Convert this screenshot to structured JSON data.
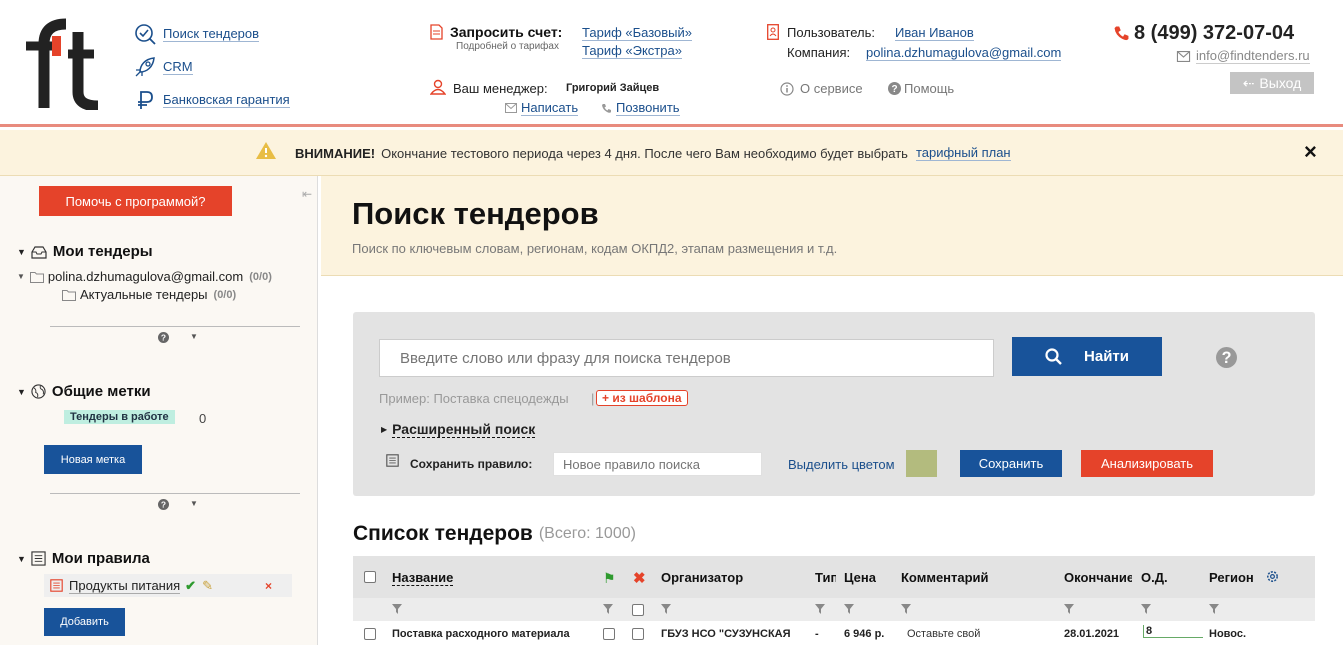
{
  "header": {
    "nav": [
      "Поиск тендеров",
      "CRM",
      "Банковская гарантия"
    ],
    "request_invoice_label": "Запросить счет:",
    "tariff_details": "Подробней о тарифах",
    "tariff_basic": "Тариф «Базовый»",
    "tariff_extra": "Тариф «Экстра»",
    "manager_label": "Ваш менеджер:",
    "manager_name": "Григорий Зайцев",
    "write_link": "Написать",
    "call_link": "Позвонить",
    "user_label": "Пользователь:",
    "user_name": "Иван Иванов",
    "company_label": "Компания:",
    "company_value": "polina.dzhumagulova@gmail.com",
    "about_link": "О сервисе",
    "help_link": "Помощь",
    "phone": "8 (499) 372-07-04",
    "email": "info@findtenders.ru",
    "logout_label": "Выход"
  },
  "warning": {
    "bold": "ВНИМАНИЕ!",
    "text": "Окончание тестового периода через 4 дня. После чего Вам необходимо будет выбрать",
    "link": "тарифный план",
    "close": "×"
  },
  "sidebar": {
    "help_button": "Помочь с программой?",
    "my_tenders_title": "Мои тендеры",
    "account_folder": "polina.dzhumagulova@gmail.com",
    "account_count": "(0/0)",
    "actual_folder": "Актуальные тендеры",
    "actual_count": "(0/0)",
    "tags_title": "Общие метки",
    "tag_label": "Тендеры в работе",
    "tag_count": "0",
    "new_tag_button": "Новая метка",
    "rules_title": "Мои правила",
    "rule_name": "Продукты питания",
    "add_button": "Добавить"
  },
  "main": {
    "title": "Поиск тендеров",
    "subtitle": "Поиск по ключевым словам, регионам, кодам ОКПД2, этапам размещения и т.д.",
    "search_placeholder": "Введите слово или фразу для поиска тендеров",
    "find_button": "Найти",
    "example_text": "Пример: Поставка спецодежды",
    "template_link": "+ из шаблона",
    "advanced_search": "Расширенный поиск",
    "save_rule_label": "Сохранить правило:",
    "rule_placeholder": "Новое правило поиска",
    "highlight_color": "Выделить цветом",
    "highlight_swatch": "#b3bb7e",
    "save_button": "Сохранить",
    "analyze_button": "Анализировать",
    "list_title": "Список тендеров",
    "list_total": "(Всего: 1000)"
  },
  "table": {
    "columns": [
      "Название",
      "Организатор",
      "Тип",
      "Цена",
      "Комментарий",
      "Окончание",
      "О.Д.",
      "Регион"
    ],
    "rows": [
      {
        "name": "Поставка расходного материала",
        "organizer": "ГБУЗ НСО \"СУЗУНСКАЯ",
        "type": "-",
        "price": "6 946 р.",
        "comment": "Оставьте свой",
        "end": "28.01.2021",
        "od": "8",
        "region": "Новос."
      }
    ]
  },
  "colors": {
    "accent_red": "#e5432a",
    "brand_blue": "#18539a",
    "link": "#1b4f8c",
    "warning_bg": "#fcf3de"
  }
}
